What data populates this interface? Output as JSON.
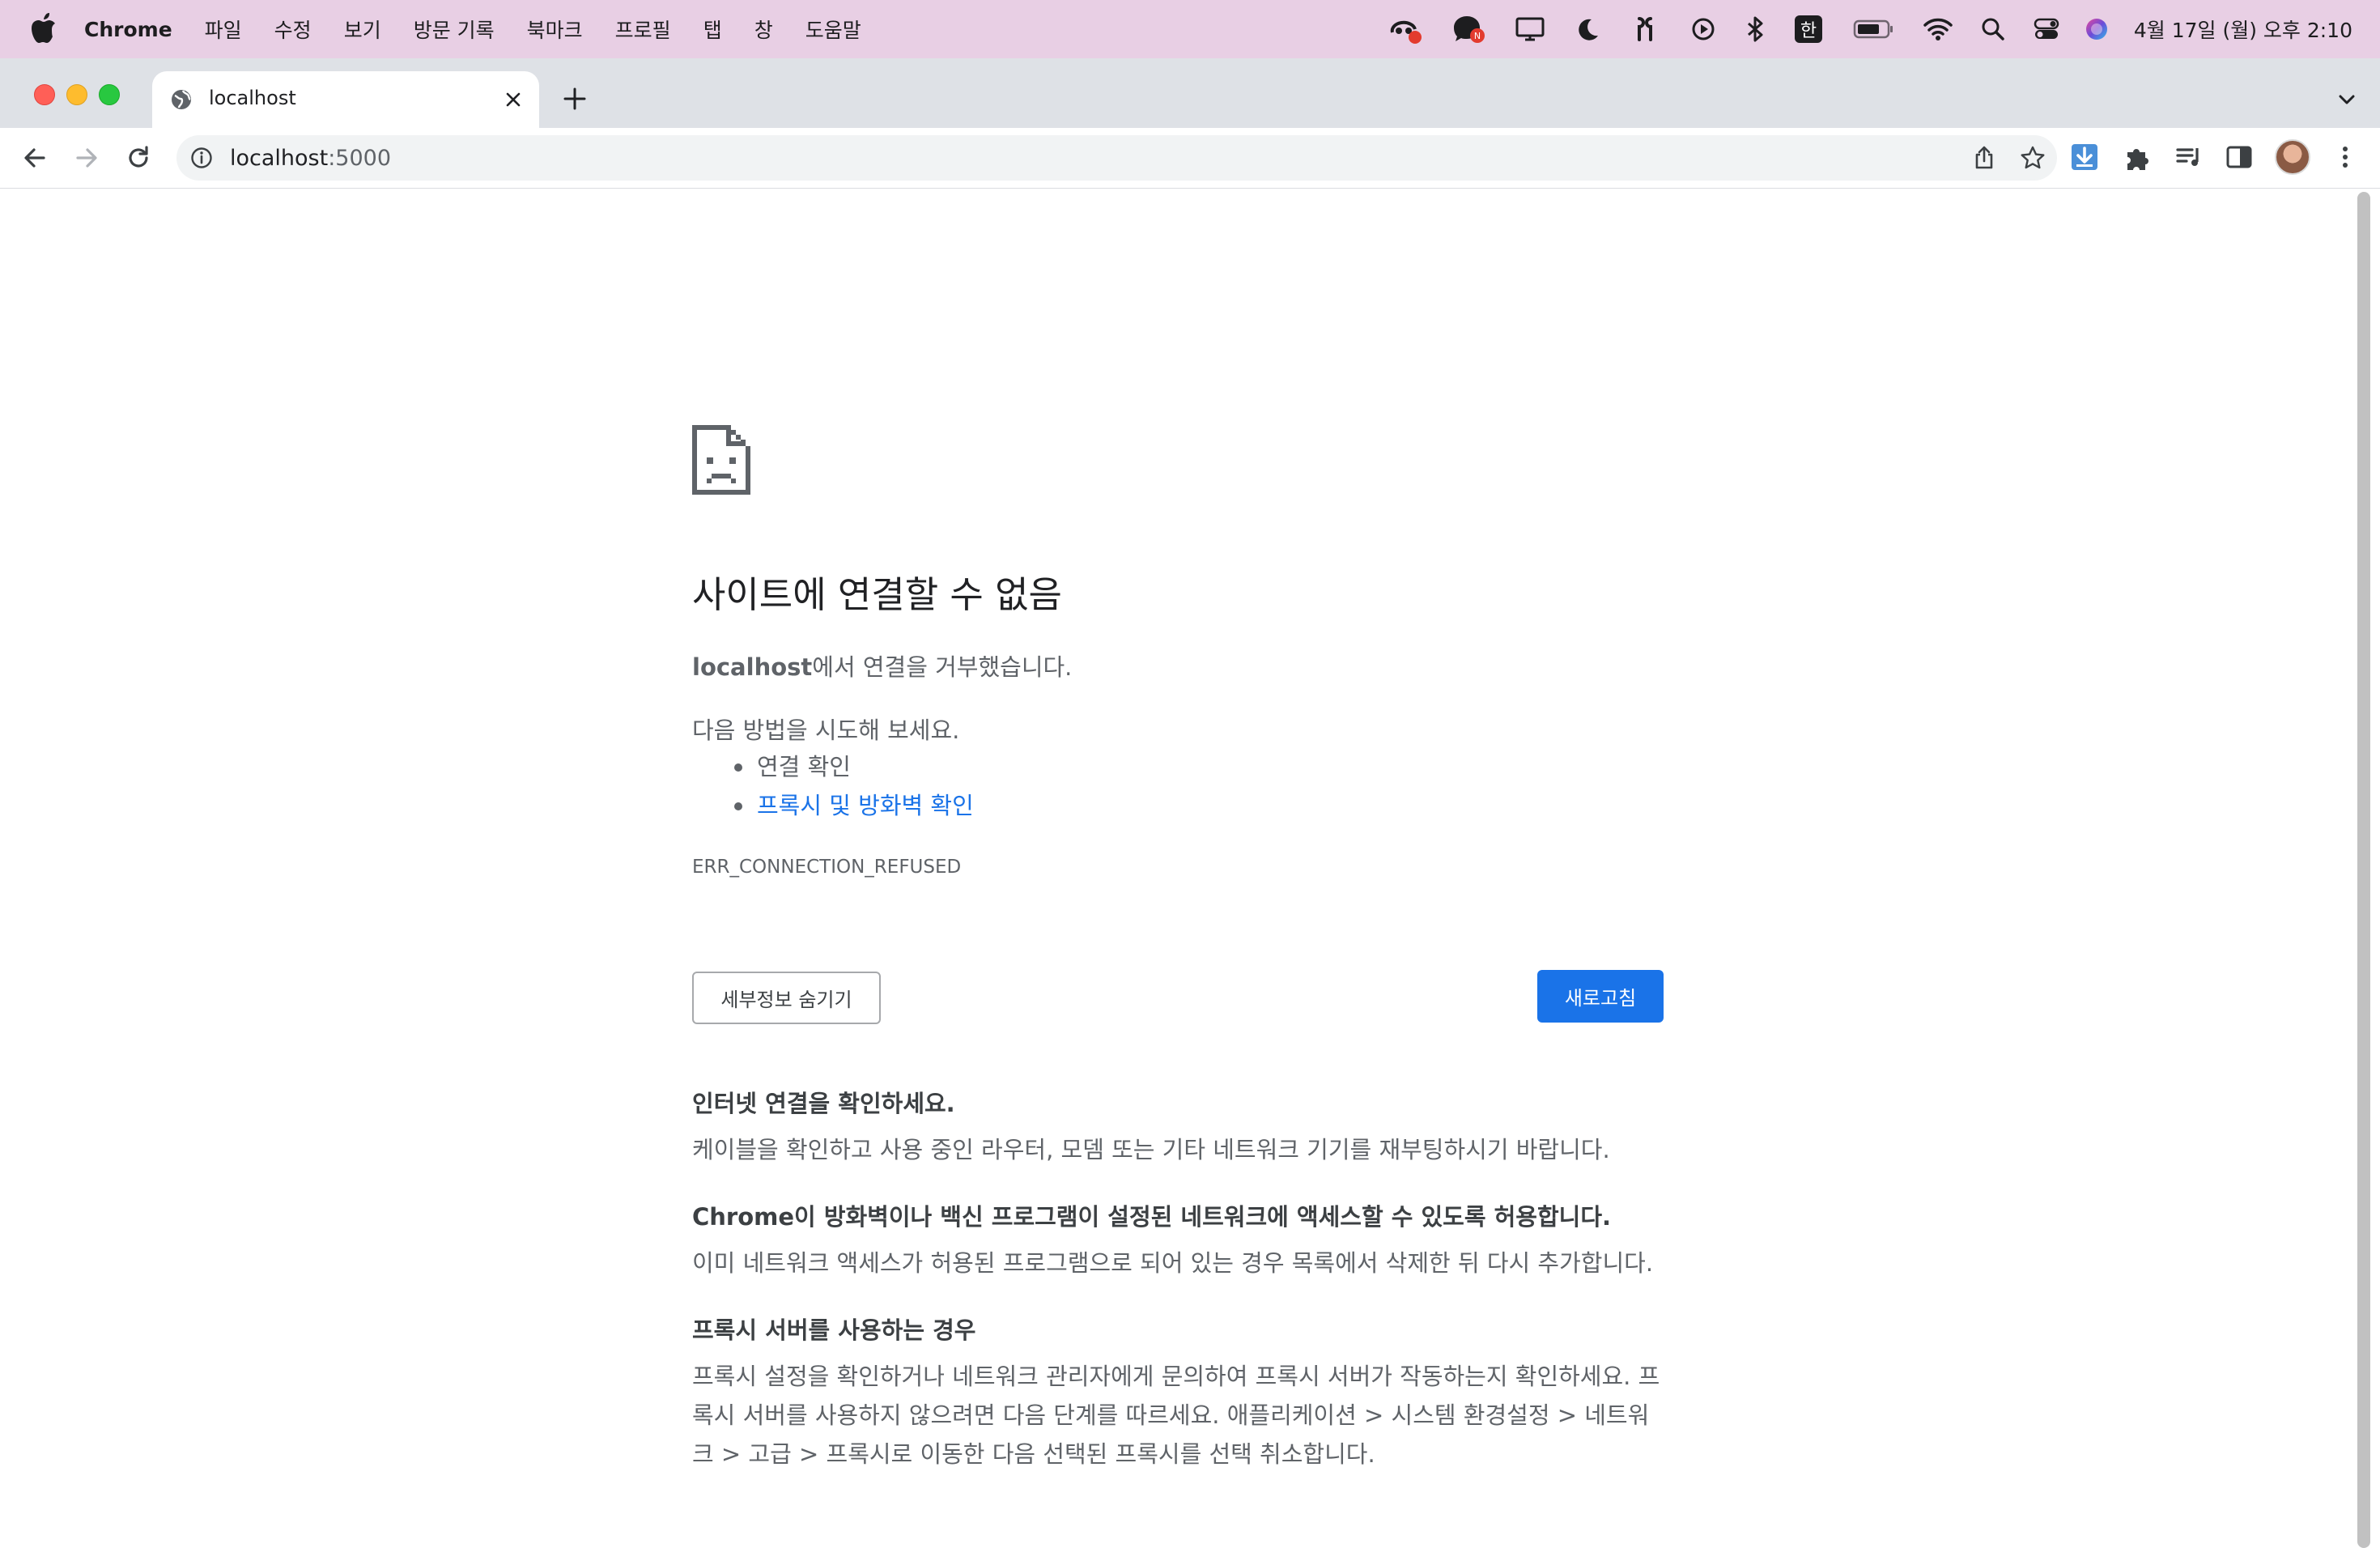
{
  "menubar": {
    "app_name": "Chrome",
    "items": [
      "파일",
      "수정",
      "보기",
      "방문 기록",
      "북마크",
      "프로필",
      "탭",
      "창",
      "도움말"
    ],
    "input_method": "한",
    "clock": "4월 17일 (월) 오후 2:10"
  },
  "browser": {
    "tab_title": "localhost",
    "url_host": "localhost",
    "url_port": ":5000"
  },
  "error_page": {
    "headline": "사이트에 연결할 수 없음",
    "summary_host": "localhost",
    "summary_rest": "에서 연결을 거부했습니다.",
    "suggestions_intro": "다음 방법을 시도해 보세요.",
    "suggestions": [
      "연결 확인",
      "프록시 및 방화벽 확인"
    ],
    "error_code": "ERR_CONNECTION_REFUSED",
    "details_button": "세부정보 숨기기",
    "reload_button": "새로고침",
    "details": [
      {
        "title": "인터넷 연결을 확인하세요.",
        "body": "케이블을 확인하고 사용 중인 라우터, 모뎀 또는 기타 네트워크 기기를 재부팅하시기 바랍니다."
      },
      {
        "title": "Chrome이 방화벽이나 백신 프로그램이 설정된 네트워크에 액세스할 수 있도록 허용합니다.",
        "body": "이미 네트워크 액세스가 허용된 프로그램으로 되어 있는 경우 목록에서 삭제한 뒤 다시 추가합니다."
      },
      {
        "title": "프록시 서버를 사용하는 경우",
        "body": "프록시 설정을 확인하거나 네트워크 관리자에게 문의하여 프록시 서버가 작동하는지 확인하세요. 프록시 서버를 사용하지 않으려면 다음 단계를 따르세요. 애플리케이션 > 시스템 환경설정 > 네트워크 > 고급 > 프록시로 이동한 다음 선택된 프록시를 선택 취소합니다."
      }
    ]
  },
  "colors": {
    "accent_blue": "#1a73e8",
    "menubar_bg": "#e8cfe4",
    "tabstrip_bg": "#dee1e6"
  },
  "icons": [
    "apple-icon",
    "copilot-icon",
    "chat-icon",
    "display-icon",
    "moon-icon",
    "airpods-icon",
    "play-icon",
    "bluetooth-icon",
    "battery-icon",
    "wifi-icon",
    "spotlight-icon",
    "control-center-icon",
    "siri-icon",
    "globe-icon",
    "close-icon",
    "plus-icon",
    "chevron-down-icon",
    "back-arrow-icon",
    "forward-arrow-icon",
    "reload-icon",
    "info-icon",
    "share-icon",
    "star-icon",
    "download-icon",
    "puzzle-icon",
    "media-icon",
    "side-panel-icon",
    "kebab-menu-icon",
    "sad-document-icon"
  ]
}
